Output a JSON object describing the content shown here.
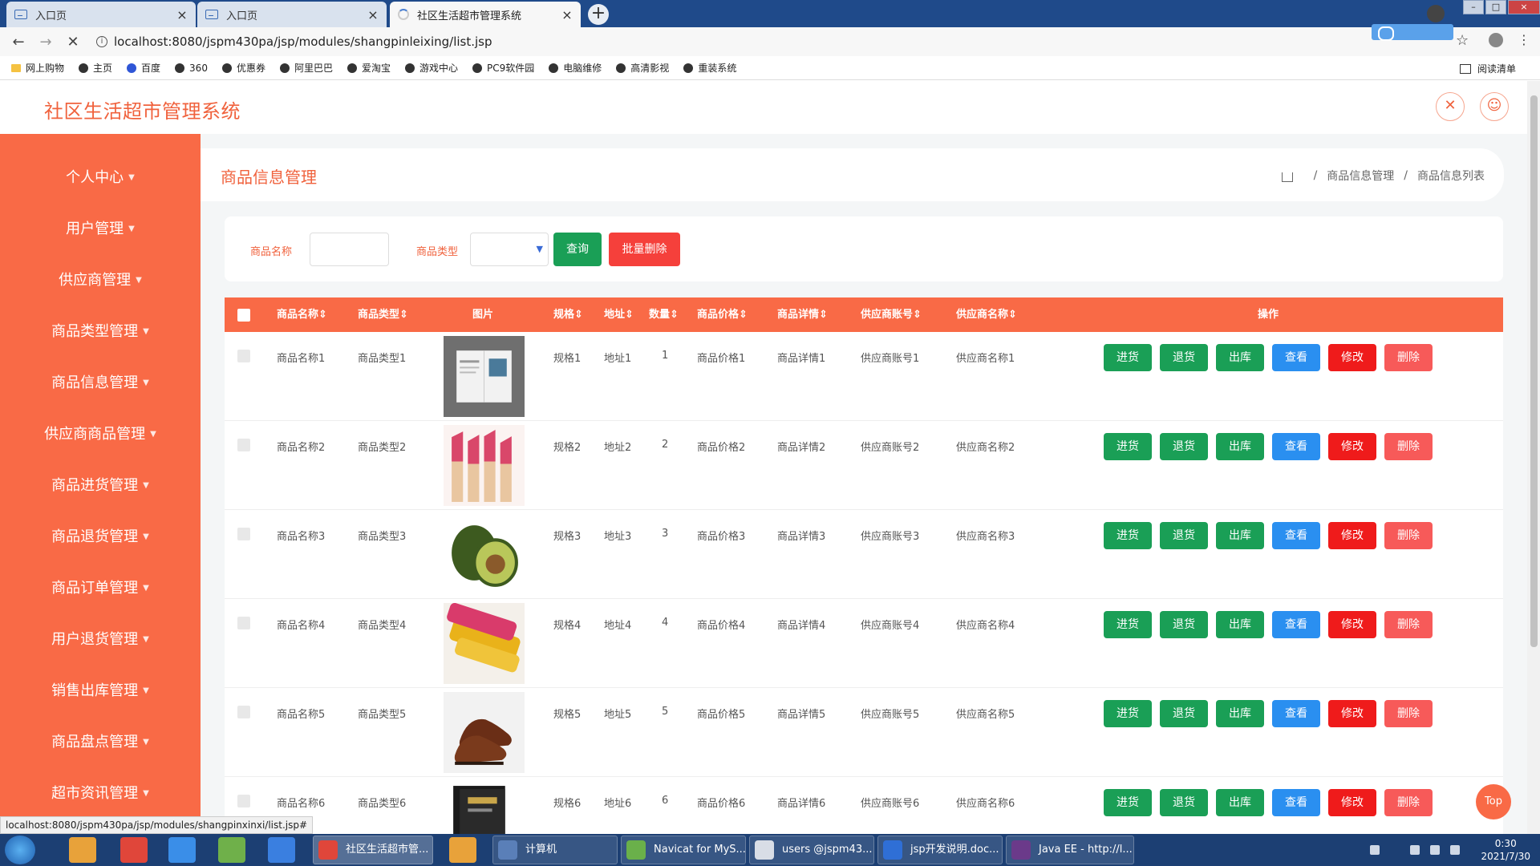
{
  "browser": {
    "tabs": [
      {
        "title": "入口页"
      },
      {
        "title": "入口页"
      },
      {
        "title": "社区生活超市管理系统"
      }
    ],
    "url": "localhost:8080/jspm430pa/jsp/modules/shangpinleixing/list.jsp",
    "bookmarks": [
      "网上购物",
      "主页",
      "百度",
      "360",
      "优惠券",
      "阿里巴巴",
      "爱淘宝",
      "游戏中心",
      "PC9软件园",
      "电脑维修",
      "高清影视",
      "重装系统"
    ],
    "reading_list": "阅读清单",
    "status_link": "localhost:8080/jspm430pa/jsp/modules/shangpinxinxi/list.jsp#"
  },
  "app": {
    "title": "社区生活超市管理系统"
  },
  "sidebar": {
    "items": [
      "个人中心",
      "用户管理",
      "供应商管理",
      "商品类型管理",
      "商品信息管理",
      "供应商商品管理",
      "商品进货管理",
      "商品退货管理",
      "商品订单管理",
      "用户退货管理",
      "销售出库管理",
      "商品盘点管理",
      "超市资讯管理"
    ]
  },
  "page": {
    "section_title": "商品信息管理",
    "breadcrumb": [
      "商品信息管理",
      "商品信息列表"
    ]
  },
  "search": {
    "name_label": "商品名称",
    "type_label": "商品类型",
    "query_button": "查询",
    "batch_delete_button": "批量删除"
  },
  "table": {
    "headers": [
      "商品名称",
      "商品类型",
      "图片",
      "规格",
      "地址",
      "数量",
      "商品价格",
      "商品详情",
      "供应商账号",
      "供应商名称",
      "操作"
    ],
    "actions": [
      "进货",
      "退货",
      "出库",
      "查看",
      "修改",
      "删除"
    ],
    "rows": [
      {
        "name": "商品名称1",
        "type": "商品类型1",
        "spec": "规格1",
        "addr": "地址1",
        "qty": "1",
        "price": "商品价格1",
        "detail": "商品详情1",
        "account": "供应商账号1",
        "supplier": "供应商名称1",
        "image": "magazine-image"
      },
      {
        "name": "商品名称2",
        "type": "商品类型2",
        "spec": "规格2",
        "addr": "地址2",
        "qty": "2",
        "price": "商品价格2",
        "detail": "商品详情2",
        "account": "供应商账号2",
        "supplier": "供应商名称2",
        "image": "lipstick-image"
      },
      {
        "name": "商品名称3",
        "type": "商品类型3",
        "spec": "规格3",
        "addr": "地址3",
        "qty": "3",
        "price": "商品价格3",
        "detail": "商品详情3",
        "account": "供应商账号3",
        "supplier": "供应商名称3",
        "image": "avocado-image"
      },
      {
        "name": "商品名称4",
        "type": "商品类型4",
        "spec": "规格4",
        "addr": "地址4",
        "qty": "4",
        "price": "商品价格4",
        "detail": "商品详情4",
        "account": "供应商账号4",
        "supplier": "供应商名称4",
        "image": "snack-image"
      },
      {
        "name": "商品名称5",
        "type": "商品类型5",
        "spec": "规格5",
        "addr": "地址5",
        "qty": "5",
        "price": "商品价格5",
        "detail": "商品详情5",
        "account": "供应商账号5",
        "supplier": "供应商名称5",
        "image": "shoes-image"
      },
      {
        "name": "商品名称6",
        "type": "商品类型6",
        "spec": "规格6",
        "addr": "地址6",
        "qty": "6",
        "price": "商品价格6",
        "detail": "商品详情6",
        "account": "供应商账号6",
        "supplier": "供应商名称6",
        "image": "book-image"
      }
    ]
  },
  "top_button": "Top",
  "taskbar": {
    "tasks": [
      "社区生活超市管...",
      "计算机",
      "Navicat for MyS...",
      "users @jspm43...",
      "jsp开发说明.doc...",
      "Java EE - http://l..."
    ],
    "time": "0:30",
    "date": "2021/7/30"
  },
  "colors": {
    "accent": "#f96a46",
    "title": "#f0623d",
    "green": "#1a9f56",
    "blue": "#2a8ff0",
    "red": "#ef1b1b",
    "pink": "#f75a59"
  }
}
